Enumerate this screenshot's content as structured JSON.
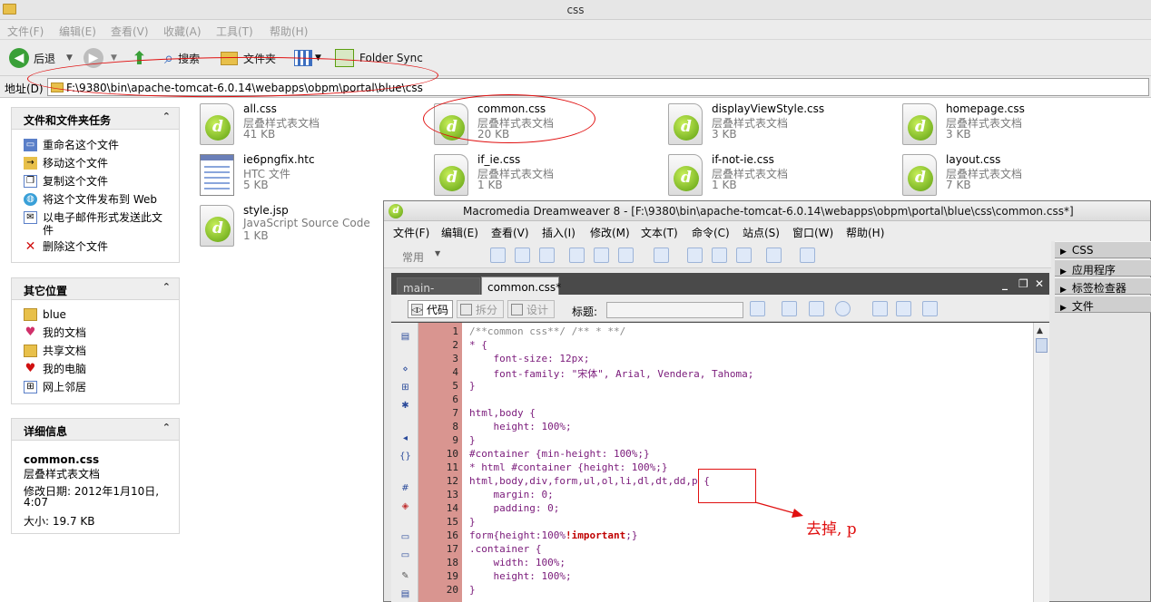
{
  "explorer": {
    "window_title": "css",
    "menu": [
      "文件(F)",
      "编辑(E)",
      "查看(V)",
      "收藏(A)",
      "工具(T)",
      "帮助(H)"
    ],
    "toolbar": {
      "back": "后退",
      "search": "搜索",
      "folders": "文件夹",
      "folder_sync": "Folder Sync"
    },
    "address_label": "地址(D)",
    "address_path": "F:\\9380\\bin\\apache-tomcat-6.0.14\\webapps\\obpm\\portal\\blue\\css",
    "tasks_panel": {
      "title": "文件和文件夹任务",
      "items": [
        "重命名这个文件",
        "移动这个文件",
        "复制这个文件",
        "将这个文件发布到 Web",
        "以电子邮件形式发送此文件",
        "删除这个文件"
      ]
    },
    "places_panel": {
      "title": "其它位置",
      "items": [
        "blue",
        "我的文档",
        "共享文档",
        "我的电脑",
        "网上邻居"
      ]
    },
    "details_panel": {
      "title": "详细信息",
      "name": "common.css",
      "type": "层叠样式表文档",
      "modified_label": "修改日期: 2012年1月10日,",
      "modified_time": "4:07",
      "size": "大小: 19.7 KB"
    },
    "files": [
      {
        "name": "all.css",
        "type": "层叠样式表文档",
        "size": "41 KB",
        "icon": "dreamweaver-css-icon"
      },
      {
        "name": "common.css",
        "type": "层叠样式表文档",
        "size": "20 KB",
        "icon": "dreamweaver-css-icon"
      },
      {
        "name": "displayViewStyle.css",
        "type": "层叠样式表文档",
        "size": "3 KB",
        "icon": "dreamweaver-css-icon"
      },
      {
        "name": "homepage.css",
        "type": "层叠样式表文档",
        "size": "3 KB",
        "icon": "dreamweaver-css-icon"
      },
      {
        "name": "ie6pngfix.htc",
        "type": "HTC 文件",
        "size": "5 KB",
        "icon": "htc-file-icon"
      },
      {
        "name": "if_ie.css",
        "type": "层叠样式表文档",
        "size": "1 KB",
        "icon": "dreamweaver-css-icon"
      },
      {
        "name": "if-not-ie.css",
        "type": "层叠样式表文档",
        "size": "1 KB",
        "icon": "dreamweaver-css-icon"
      },
      {
        "name": "layout.css",
        "type": "层叠样式表文档",
        "size": "7 KB",
        "icon": "dreamweaver-css-icon"
      },
      {
        "name": "style.jsp",
        "type": "JavaScript Source Code",
        "size": "1 KB",
        "icon": "dreamweaver-js-icon"
      }
    ]
  },
  "dreamweaver": {
    "title": "Macromedia Dreamweaver 8 - [F:\\9380\\bin\\apache-tomcat-6.0.14\\webapps\\obpm\\portal\\blue\\css\\common.css*]",
    "menu": [
      "文件(F)",
      "编辑(E)",
      "查看(V)",
      "插入(I)",
      "修改(M)",
      "文本(T)",
      "命令(C)",
      "站点(S)",
      "窗口(W)",
      "帮助(H)"
    ],
    "insert_category": "常用",
    "tabs": [
      "main-front.css",
      "common.css*"
    ],
    "view_buttons": {
      "code": "代码",
      "split": "拆分",
      "design": "设计"
    },
    "title_label": "标题:",
    "panel_groups": [
      "CSS",
      "应用程序",
      "标签检查器",
      "文件"
    ],
    "code_lines": [
      "/**common css**/ /** * **/",
      "* {",
      "    font-size: 12px;",
      "    font-family: \"宋体\", Arial, Vendera, Tahoma;",
      "}",
      "",
      "html,body {",
      "    height: 100%;",
      "}",
      "#container {min-height: 100%;}",
      "* html #container {height: 100%;}",
      "html,body,div,form,ul,ol,li,dl,dt,dd,p {",
      "    margin: 0;",
      "    padding: 0;",
      "}",
      "form{height:100%!important;}",
      ".container {",
      "    width: 100%;",
      "    height: 100%;",
      "}"
    ]
  },
  "annotation": {
    "note": "去掉, p"
  },
  "colors": {
    "annotation_red": "#e01010",
    "gutter": "#d99590",
    "code_purple": "#7a1a7a",
    "important_red": "#c00000"
  }
}
